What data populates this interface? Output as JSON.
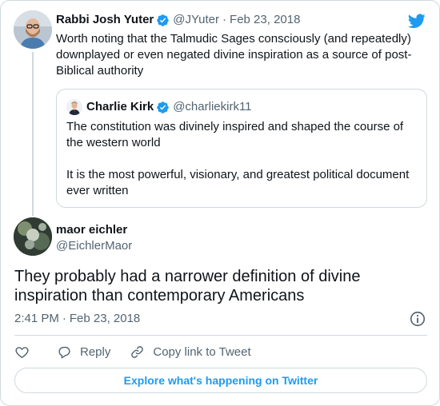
{
  "parent_tweet": {
    "author_name": "Rabbi Josh Yuter",
    "handle": "@JYuter",
    "separator": "·",
    "date": "Feb 23, 2018",
    "text": "Worth noting that the Talmudic Sages consciously (and repeatedly) downplayed or even negated divine inspiration as a source of post-Biblical authority"
  },
  "quoted_tweet": {
    "author_name": "Charlie Kirk",
    "handle": "@charliekirk11",
    "paragraph_1": "The constitution was divinely inspired and shaped the course of the western world",
    "paragraph_2": "It is the most powerful, visionary, and greatest political document ever written"
  },
  "reply_tweet": {
    "author_name": "maor eichler",
    "handle": "@EichlerMaor",
    "text": "They probably had a narrower definition of divine inspiration than contemporary Americans",
    "time": "2:41 PM",
    "separator": "·",
    "date": "Feb 23, 2018"
  },
  "actions": {
    "reply_label": "Reply",
    "copy_link_label": "Copy link to Tweet"
  },
  "explore_label": "Explore what's happening on Twitter",
  "icons": {
    "brand": "twitter-bird-icon",
    "verified": "verified-badge-icon",
    "like": "heart-icon",
    "reply": "reply-bubble-icon",
    "copy": "link-icon",
    "info": "info-icon"
  },
  "colors": {
    "accent": "#1d9bf0",
    "text": "#0f1419",
    "muted": "#536471",
    "border": "#cfd9de"
  }
}
